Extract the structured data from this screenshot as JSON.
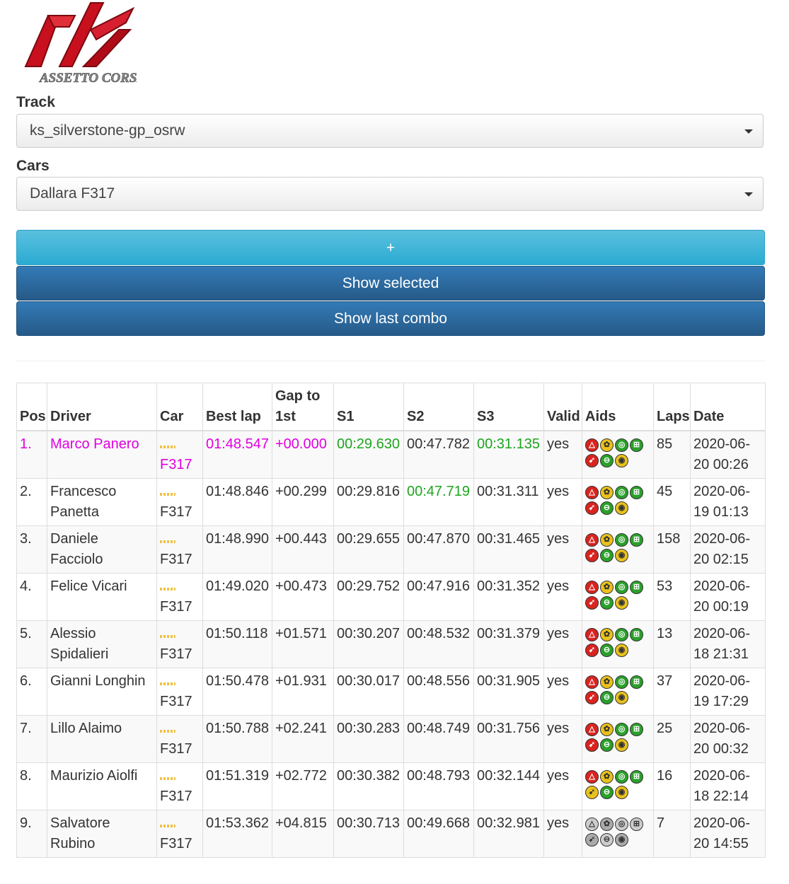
{
  "logo": {
    "text": "ASSETTO CORSA"
  },
  "form": {
    "track_label": "Track",
    "track_value": "ks_silverstone-gp_osrw",
    "cars_label": "Cars",
    "cars_value": "Dallara F317"
  },
  "buttons": {
    "plus": "+",
    "show_selected": "Show selected",
    "show_last_combo": "Show last combo"
  },
  "table": {
    "headers": {
      "pos": "Pos",
      "driver": "Driver",
      "car": "Car",
      "best_lap": "Best lap",
      "gap": "Gap to 1st",
      "s1": "S1",
      "s2": "S2",
      "s3": "S3",
      "valid": "Valid",
      "aids": "Aids",
      "laps": "Laps",
      "date": "Date"
    },
    "rows": [
      {
        "pos": "1.",
        "driver": "Marco Panero",
        "car": "F317",
        "best": "01:48.547",
        "gap": "+00.000",
        "s1": "00:29.630",
        "s2": "00:47.782",
        "s3": "00:31.135",
        "valid": "yes",
        "laps": "85",
        "date": "2020-06-20 00:26"
      },
      {
        "pos": "2.",
        "driver": "Francesco Panetta",
        "car": "F317",
        "best": "01:48.846",
        "gap": "+00.299",
        "s1": "00:29.816",
        "s2": "00:47.719",
        "s3": "00:31.311",
        "valid": "yes",
        "laps": "45",
        "date": "2020-06-19 01:13"
      },
      {
        "pos": "3.",
        "driver": "Daniele Facciolo",
        "car": "F317",
        "best": "01:48.990",
        "gap": "+00.443",
        "s1": "00:29.655",
        "s2": "00:47.870",
        "s3": "00:31.465",
        "valid": "yes",
        "laps": "158",
        "date": "2020-06-20 02:15"
      },
      {
        "pos": "4.",
        "driver": "Felice Vicari",
        "car": "F317",
        "best": "01:49.020",
        "gap": "+00.473",
        "s1": "00:29.752",
        "s2": "00:47.916",
        "s3": "00:31.352",
        "valid": "yes",
        "laps": "53",
        "date": "2020-06-20 00:19"
      },
      {
        "pos": "5.",
        "driver": "Alessio Spidalieri",
        "car": "F317",
        "best": "01:50.118",
        "gap": "+01.571",
        "s1": "00:30.207",
        "s2": "00:48.532",
        "s3": "00:31.379",
        "valid": "yes",
        "laps": "13",
        "date": "2020-06-18 21:31"
      },
      {
        "pos": "6.",
        "driver": "Gianni Longhin",
        "car": "F317",
        "best": "01:50.478",
        "gap": "+01.931",
        "s1": "00:30.017",
        "s2": "00:48.556",
        "s3": "00:31.905",
        "valid": "yes",
        "laps": "37",
        "date": "2020-06-19 17:29"
      },
      {
        "pos": "7.",
        "driver": "Lillo Alaimo",
        "car": "F317",
        "best": "01:50.788",
        "gap": "+02.241",
        "s1": "00:30.283",
        "s2": "00:48.749",
        "s3": "00:31.756",
        "valid": "yes",
        "laps": "25",
        "date": "2020-06-20 00:32"
      },
      {
        "pos": "8.",
        "driver": "Maurizio Aiolfi",
        "car": "F317",
        "best": "01:51.319",
        "gap": "+02.772",
        "s1": "00:30.382",
        "s2": "00:48.793",
        "s3": "00:32.144",
        "valid": "yes",
        "laps": "16",
        "date": "2020-06-18 22:14"
      },
      {
        "pos": "9.",
        "driver": "Salvatore Rubino",
        "car": "F317",
        "best": "01:53.362",
        "gap": "+04.815",
        "s1": "00:30.713",
        "s2": "00:49.668",
        "s3": "00:32.981",
        "valid": "yes",
        "laps": "7",
        "date": "2020-06-20 14:55"
      }
    ],
    "aid_icons": [
      "abs-icon",
      "tc-icon",
      "stability-icon",
      "auto-gear-icon",
      "ideal-line-icon",
      "auto-clutch-icon",
      "tyre-wear-icon"
    ],
    "aid_colors": {
      "standard": [
        "#d9231f",
        "#e9c11c",
        "#2aa02a",
        "#2aa02a",
        "#d9231f",
        "#2aa02a",
        "#e9c11c"
      ],
      "row8": [
        "#d9231f",
        "#e9c11c",
        "#2aa02a",
        "#2aa02a",
        "#e9c11c",
        "#2aa02a",
        "#e9c11c"
      ],
      "row9": [
        "#cccccc",
        "#aaaaaa",
        "#cccccc",
        "#cccccc",
        "#aaaaaa",
        "#cccccc",
        "#aaaaaa"
      ]
    },
    "highlight_color": "#e000e0",
    "best_sector_color": "#1ea51e"
  }
}
